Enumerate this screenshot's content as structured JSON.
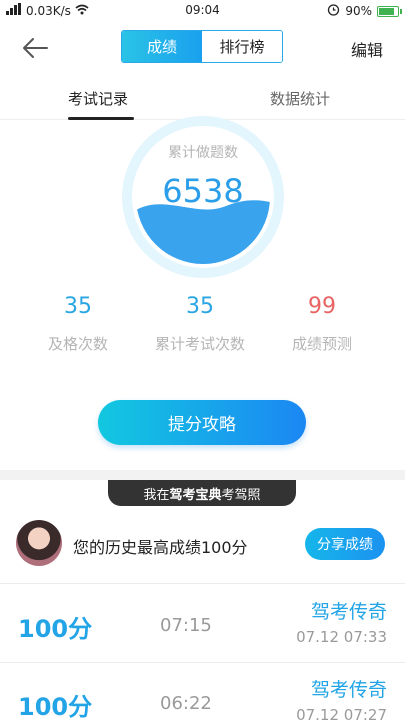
{
  "status_bar": {
    "speed": "0.03K/s",
    "time": "09:04",
    "battery": "90%"
  },
  "nav": {
    "segments": [
      "成绩",
      "排行榜"
    ],
    "active_segment": 0,
    "edit_label": "编辑"
  },
  "tabs": [
    "考试记录",
    "数据统计"
  ],
  "summary": {
    "label": "累计做题数",
    "value": "6538",
    "metrics": [
      {
        "value": "35",
        "label": "及格次数",
        "color": "#2aa6e2"
      },
      {
        "value": "35",
        "label": "累计考试次数",
        "color": "#2aa6e2"
      },
      {
        "value": "99",
        "label": "成绩预测",
        "color": "#e86464"
      }
    ],
    "button_label": "提分攻略"
  },
  "banner": {
    "prefix": "我在",
    "brand": "驾考宝典",
    "suffix": "考驾照"
  },
  "best": {
    "text": "您的历史最高成绩100分",
    "share_label": "分享成绩"
  },
  "records": [
    {
      "score": "100分",
      "duration": "07:15",
      "rank": "驾考传奇",
      "date": "07.12  07:33"
    },
    {
      "score": "100分",
      "duration": "06:22",
      "rank": "驾考传奇",
      "date": "07.12  07:27"
    }
  ],
  "colors": {
    "accent": "#1aa0ee",
    "highlight": "#e86464"
  }
}
